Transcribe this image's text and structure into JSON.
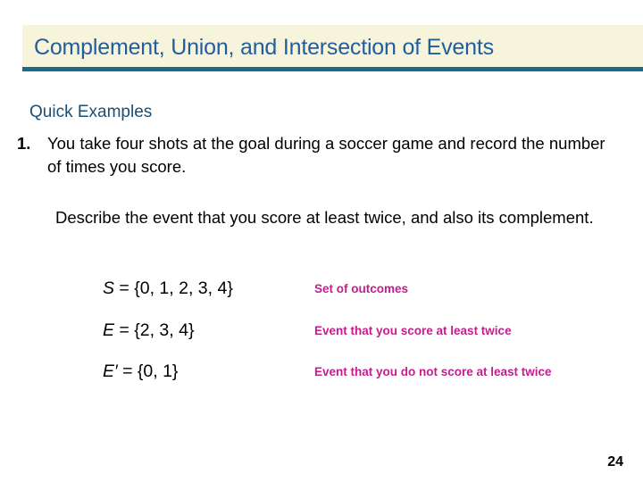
{
  "slide": {
    "title": "Complement, Union, and Intersection of Events",
    "banner_bg": "#f7f4dc",
    "banner_rule_color": "#1b6a8c",
    "title_color": "#225e9e",
    "page_number": "24"
  },
  "body": {
    "section_heading": "Quick Examples",
    "section_heading_color": "#1d4e74",
    "examples": [
      {
        "number": "1.",
        "text": "You take four shots at the goal during a soccer game and record the number of times you score."
      }
    ],
    "describe_paragraph": "Describe the event that you score at least twice, and also its complement.",
    "note_color": "#c61d8e",
    "equations": [
      {
        "symbol": "S",
        "rest": " = {0, 1, 2, 3, 4}",
        "note": "Set of outcomes"
      },
      {
        "symbol": "E",
        "rest": " = {2, 3, 4}",
        "note": "Event that you score at least twice"
      },
      {
        "symbol": "E′",
        "rest": " = {0, 1}",
        "note": "Event that you do not score at least twice"
      }
    ]
  }
}
